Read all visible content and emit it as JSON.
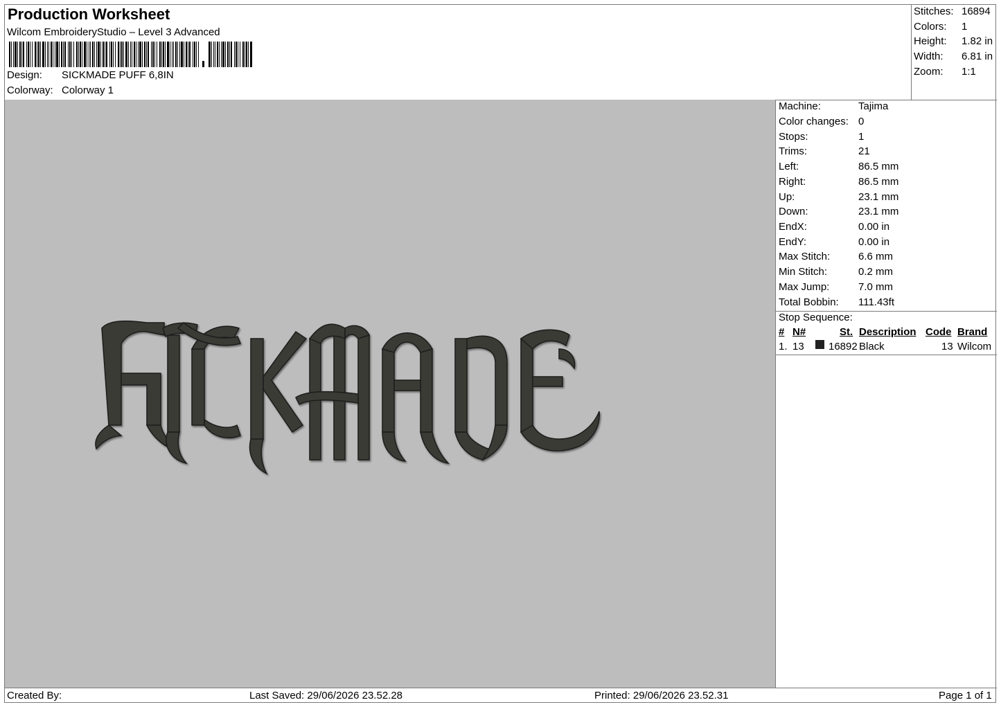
{
  "header": {
    "title": "Production Worksheet",
    "software": "Wilcom EmbroideryStudio – Level 3 Advanced",
    "design_label": "Design:",
    "design_value": "SICKMADE PUFF 6,8IN",
    "colorway_label": "Colorway:",
    "colorway_value": "Colorway 1"
  },
  "summary": {
    "stitches_label": "Stitches:",
    "stitches_value": "16894",
    "colors_label": "Colors:",
    "colors_value": "1",
    "height_label": "Height:",
    "height_value": "1.82 in",
    "width_label": "Width:",
    "width_value": "6.81 in",
    "zoom_label": "Zoom:",
    "zoom_value": "1:1"
  },
  "info": {
    "machine_label": "Machine:",
    "machine_value": "Tajima",
    "color_changes_label": "Color changes:",
    "color_changes_value": "0",
    "stops_label": "Stops:",
    "stops_value": "1",
    "trims_label": "Trims:",
    "trims_value": "21",
    "left_label": "Left:",
    "left_value": "86.5 mm",
    "right_label": "Right:",
    "right_value": "86.5 mm",
    "up_label": "Up:",
    "up_value": "23.1 mm",
    "down_label": "Down:",
    "down_value": "23.1 mm",
    "endx_label": "EndX:",
    "endx_value": "0.00 in",
    "endy_label": "EndY:",
    "endy_value": "0.00 in",
    "max_stitch_label": "Max Stitch:",
    "max_stitch_value": "6.6 mm",
    "min_stitch_label": "Min Stitch:",
    "min_stitch_value": "0.2 mm",
    "max_jump_label": "Max Jump:",
    "max_jump_value": "7.0 mm",
    "total_bobbin_label": "Total Bobbin:",
    "total_bobbin_value": "111.43ft"
  },
  "stop_sequence": {
    "title": "Stop Sequence:",
    "columns": {
      "num": "#",
      "needle": "N#",
      "stitches": "St.",
      "description": "Description",
      "code": "Code",
      "brand": "Brand"
    },
    "rows": [
      {
        "num": "1.",
        "needle": "13",
        "color": "#222222",
        "stitches": "16892",
        "description": "Black",
        "code": "13",
        "brand": "Wilcom"
      }
    ]
  },
  "footer": {
    "created_by": "Created By:",
    "last_saved": "Last Saved: 29/06/2026 23.52.28",
    "printed": "Printed: 29/06/2026 23.52.31",
    "page": "Page 1 of 1"
  },
  "colors": {
    "preview_background": "#bdbdbd",
    "thread": "#3a3a36",
    "border": "#7a7a7a"
  }
}
